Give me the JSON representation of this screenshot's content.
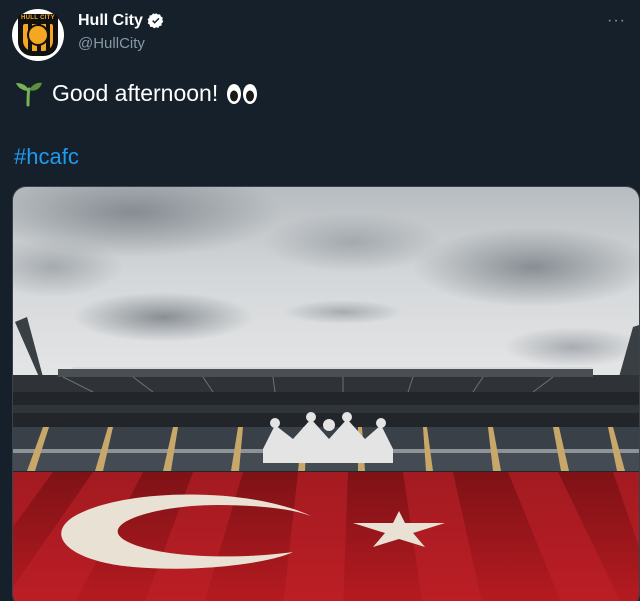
{
  "account": {
    "display_name": "Hull City",
    "handle": "@HullCity",
    "verified": true,
    "avatar_icon": "hull-city-crest-icon",
    "badge_text": "HULL CITY"
  },
  "tweet": {
    "text": "Good afternoon!",
    "leading_emoji": "seedling-icon",
    "trailing_emoji": "eyes-icon",
    "hashtag": "#hcafc"
  },
  "menu": {
    "more_label": "···"
  },
  "media": {
    "description_icon": "stadium-photo",
    "accent_colors": {
      "pitch_red": "#b01a1f",
      "sky": "#cfd2d4",
      "link": "#1d9bf0"
    }
  }
}
